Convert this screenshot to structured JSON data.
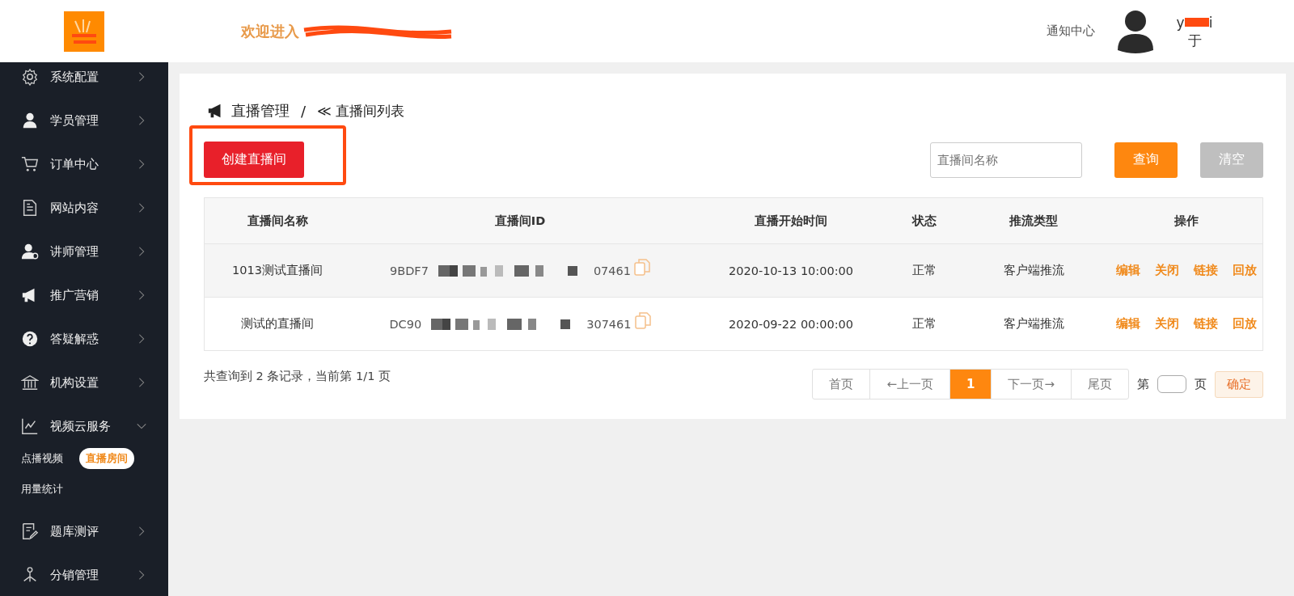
{
  "header": {
    "welcome": "欢迎进入",
    "notice": "通知中心",
    "user": {
      "name_start": "y",
      "name_end": "i",
      "nickname": "于"
    }
  },
  "sidebar": {
    "items": [
      {
        "label": "系统配置",
        "expanded": false
      },
      {
        "label": "学员管理",
        "expanded": false
      },
      {
        "label": "订单中心",
        "expanded": false
      },
      {
        "label": "网站内容",
        "expanded": false
      },
      {
        "label": "讲师管理",
        "expanded": false
      },
      {
        "label": "推广营销",
        "expanded": false
      },
      {
        "label": "答疑解惑",
        "expanded": false
      },
      {
        "label": "机构设置",
        "expanded": false
      },
      {
        "label": "视频云服务",
        "expanded": true,
        "children": [
          {
            "label": "点播视频",
            "selected": false
          },
          {
            "label": "直播房间",
            "selected": true
          },
          {
            "label": "用量统计",
            "selected": false
          }
        ]
      },
      {
        "label": "题库测评",
        "expanded": false
      },
      {
        "label": "分销管理",
        "expanded": false
      }
    ]
  },
  "breadcrumb": {
    "section": "直播管理",
    "separator": "/",
    "page": "≪ 直播间列表"
  },
  "create_button": "创建直播间",
  "search": {
    "placeholder": "直播间名称",
    "query_button": "查询",
    "clear_button": "清空"
  },
  "table": {
    "columns": [
      "直播间名称",
      "直播间ID",
      "直播开始时间",
      "状态",
      "推流类型",
      "操作"
    ],
    "rows": [
      {
        "name": "1013测试直播间",
        "id_start": "9BDF7",
        "id_end": "07461",
        "start_time": "2020-10-13 10:00:00",
        "status": "正常",
        "push_type": "客户端推流",
        "actions": [
          "编辑",
          "关闭",
          "链接",
          "回放"
        ]
      },
      {
        "name": "测试的直播间",
        "id_start": "DC90",
        "id_end": "307461",
        "start_time": "2020-09-22 00:00:00",
        "status": "正常",
        "push_type": "客户端推流",
        "actions": [
          "编辑",
          "关闭",
          "链接",
          "回放"
        ]
      }
    ]
  },
  "summary": "共查询到 2 条记录，当前第 1/1 页",
  "pagination": {
    "pages": [
      {
        "label": "首页",
        "selected": false
      },
      {
        "label": "←上一页",
        "selected": false
      },
      {
        "label": "1",
        "selected": true
      },
      {
        "label": "下一页→",
        "selected": false
      },
      {
        "label": "尾页",
        "selected": false
      }
    ],
    "goto_prefix": "第",
    "goto_suffix": "页",
    "confirm": "确定"
  }
}
